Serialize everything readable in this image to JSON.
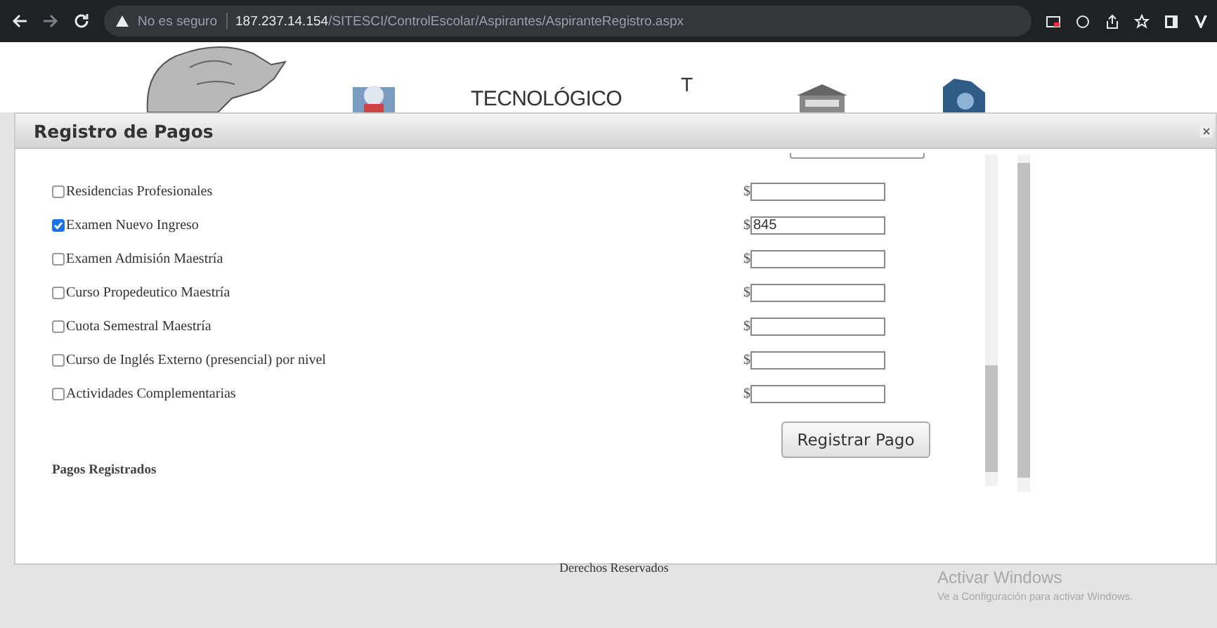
{
  "browser": {
    "security": "No es seguro",
    "url_host": "187.237.14.154",
    "url_path": "/SITESCI/ControlEscolar/Aspirantes/AspiranteRegistro.aspx"
  },
  "header": {
    "title": "TECNOLÓGICO",
    "letter": "T"
  },
  "dialog": {
    "title": "Registro de Pagos",
    "payments": [
      {
        "label": "Residencias Profesionales",
        "checked": false,
        "currency": "$"
      },
      {
        "label": "Examen Nuevo Ingreso",
        "checked": true,
        "currency": "$",
        "amount": "845"
      },
      {
        "label": "Examen Admisión Maestría",
        "checked": false,
        "currency": "$"
      },
      {
        "label": "Curso Propedeutico Maestría",
        "checked": false,
        "currency": "$"
      },
      {
        "label": "Cuota Semestral Maestría",
        "checked": false,
        "currency": "$"
      },
      {
        "label": "Curso de Inglés Externo (presencial) por nivel",
        "checked": false,
        "currency": "$"
      },
      {
        "label": "Actividades Complementarias",
        "checked": false,
        "currency": "$"
      }
    ],
    "button": "Registrar Pago",
    "section": "Pagos Registrados"
  },
  "footer": "Derechos Reservados",
  "activation": {
    "title": "Activar Windows",
    "subtitle": "Ve a Configuración para activar Windows."
  }
}
